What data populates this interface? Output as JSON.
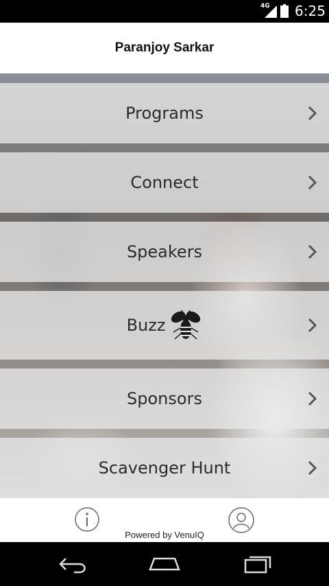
{
  "status_bar": {
    "network": "4G",
    "time": "6:25",
    "icons": [
      "signal-icon",
      "battery-icon"
    ]
  },
  "header": {
    "title": "Paranjoy Sarkar"
  },
  "menu": {
    "items": [
      {
        "label": "Programs",
        "icon": "chevron-right-icon"
      },
      {
        "label": "Connect",
        "icon": "chevron-right-icon"
      },
      {
        "label": "Speakers",
        "icon": "chevron-right-icon"
      },
      {
        "label": "Buzz",
        "icon": "bee-icon"
      },
      {
        "label": "Sponsors",
        "icon": "chevron-right-icon"
      },
      {
        "label": "Scavenger Hunt",
        "icon": "chevron-right-icon"
      }
    ]
  },
  "footer": {
    "powered_by": "Powered by VenuIQ",
    "icons": [
      "info-icon",
      "profile-icon"
    ]
  },
  "nav_bar": {
    "icons": [
      "back-icon",
      "home-icon",
      "recent-apps-icon"
    ]
  },
  "colors": {
    "status_bar_bg": "#000000",
    "header_bg": "#ffffff",
    "menu_item_bg": "#e8e8e8",
    "text": "#2a2a2a"
  }
}
